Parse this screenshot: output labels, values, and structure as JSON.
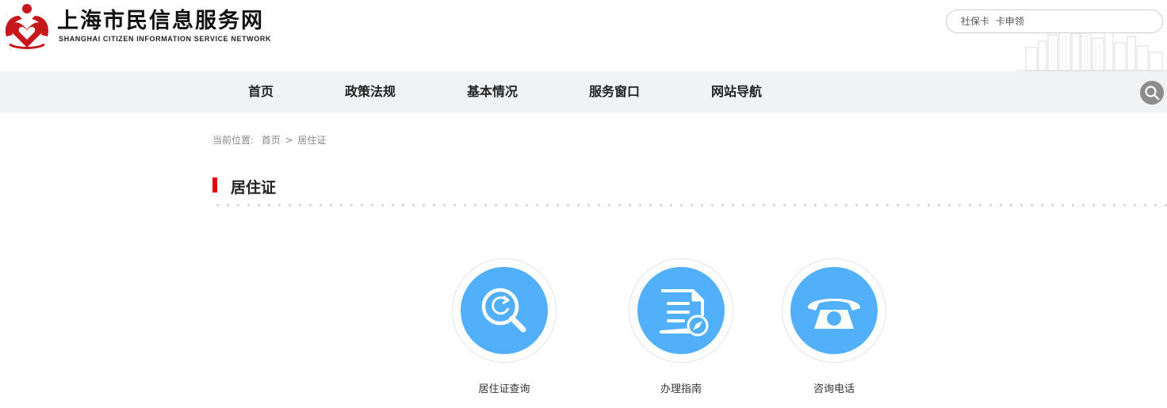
{
  "header": {
    "title": "上海市民信息服务网",
    "subtitle": "SHANGHAI CITIZEN INFORMATION SERVICE NETWORK",
    "logo_icon": "heart-people-logo-icon",
    "brand_color": "#c8161d"
  },
  "nav": {
    "items": [
      {
        "label": "首页"
      },
      {
        "label": "政策法规"
      },
      {
        "label": "基本情况"
      },
      {
        "label": "服务窗口"
      },
      {
        "label": "网站导航"
      }
    ]
  },
  "search": {
    "placeholder": "社保卡  卡申领",
    "icon": "search-icon"
  },
  "breadcrumb": {
    "prefix": "当前位置:",
    "home": "首页",
    "separator": ">",
    "current": "居住证"
  },
  "section": {
    "title": "居住证",
    "accent": "#e60012"
  },
  "services": [
    {
      "label": "居住证查询",
      "icon": "search-refresh-icon"
    },
    {
      "label": "办理指南",
      "icon": "document-compass-icon"
    },
    {
      "label": "咨询电话",
      "icon": "telephone-icon"
    }
  ],
  "colors": {
    "icon_disc": "#52b0fb",
    "nav_bg": "#f1f2f4"
  }
}
